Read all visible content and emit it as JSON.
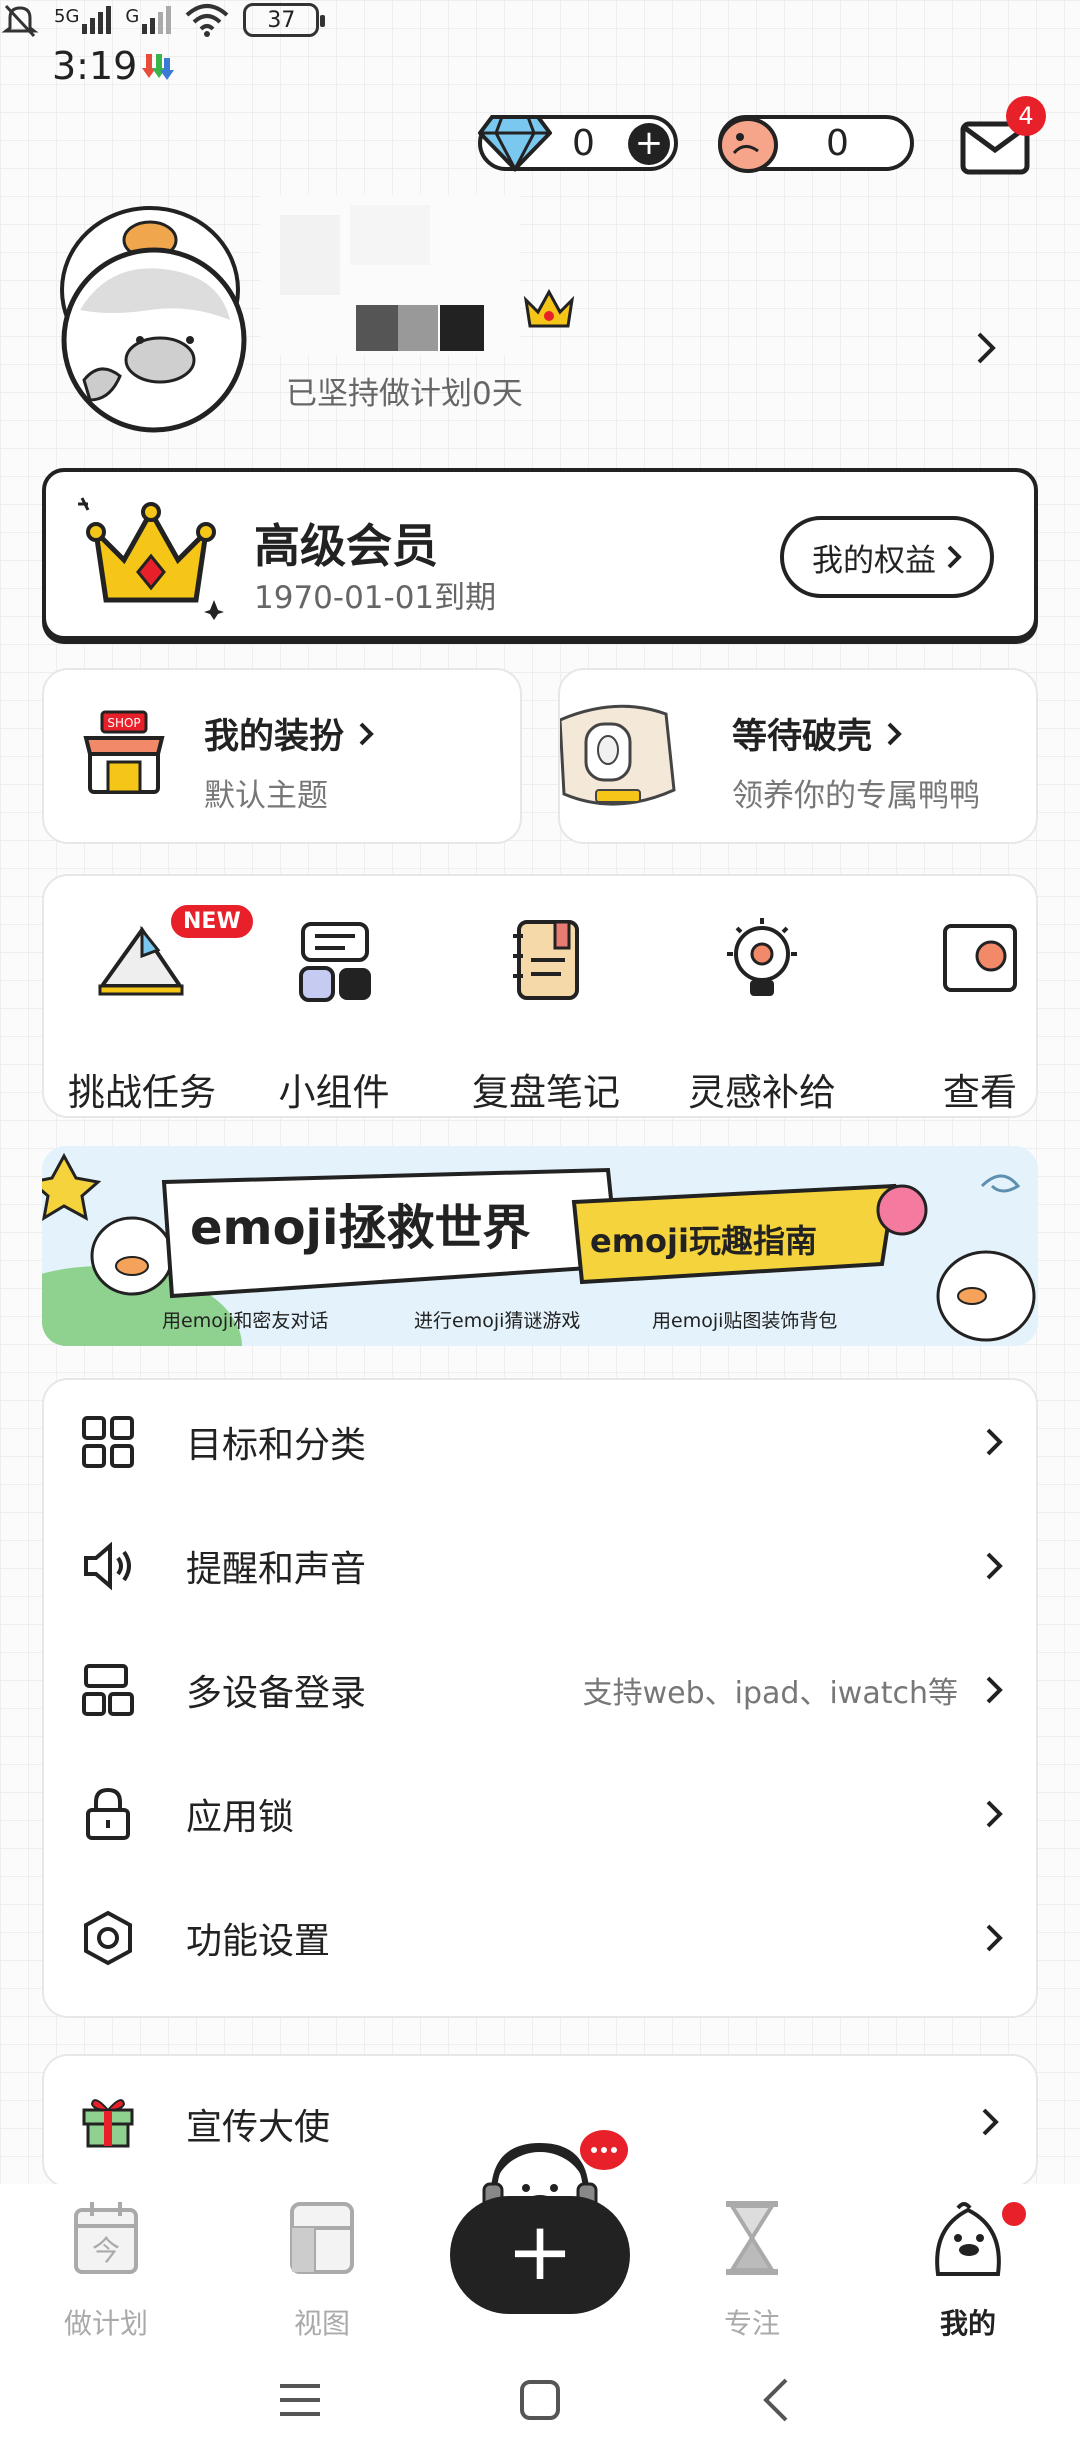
{
  "status_bar": {
    "time": "3:19",
    "network_label": "5G",
    "network_label_2": "G",
    "battery": "37"
  },
  "wallet": {
    "diamonds": "0",
    "eggs": "0",
    "mail_badge": "4"
  },
  "profile": {
    "persist_text": "已坚持做计划0天"
  },
  "member": {
    "title": "高级会员",
    "expiry": "1970-01-01到期",
    "rights_button": "我的权益"
  },
  "cards": {
    "dress_title": "我的装扮",
    "dress_sub": "默认主题",
    "hatch_title": "等待破壳",
    "hatch_sub": "领养你的专属鸭鸭",
    "shop_sign": "SHOP"
  },
  "quick": [
    {
      "label": "挑战任务",
      "icon": "challenge-icon",
      "badge": "NEW"
    },
    {
      "label": "小组件",
      "icon": "widget-icon"
    },
    {
      "label": "复盘笔记",
      "icon": "notebook-icon"
    },
    {
      "label": "灵感补给",
      "icon": "lightbulb-icon"
    },
    {
      "label": "查看",
      "icon": "view-icon"
    }
  ],
  "banner": {
    "title": "emoji拯救世界",
    "tag": "emoji玩趣指南",
    "items": [
      "用emoji和密友对话",
      "进行emoji猜谜游戏",
      "用emoji贴图装饰背包"
    ]
  },
  "settings": [
    {
      "label": "目标和分类",
      "icon": "grid-icon",
      "extra": ""
    },
    {
      "label": "提醒和声音",
      "icon": "speaker-icon",
      "extra": ""
    },
    {
      "label": "多设备登录",
      "icon": "devices-icon",
      "extra": "支持web、ipad、iwatch等"
    },
    {
      "label": "应用锁",
      "icon": "lock-icon",
      "extra": ""
    },
    {
      "label": "功能设置",
      "icon": "hexagon-settings-icon",
      "extra": ""
    }
  ],
  "promo": {
    "label": "宣传大使",
    "icon": "gift-icon"
  },
  "bottom_nav": {
    "items": [
      {
        "label": "做计划",
        "icon": "calendar-today-icon",
        "glyph": "今"
      },
      {
        "label": "视图",
        "icon": "layout-icon"
      },
      {
        "label": "",
        "icon": "plus-icon"
      },
      {
        "label": "专注",
        "icon": "hourglass-icon"
      },
      {
        "label": "我的",
        "icon": "duck-profile-icon"
      }
    ],
    "active": "我的",
    "fab_label": "+"
  },
  "colors": {
    "accent_dark": "#222222",
    "badge_red": "#e8202a",
    "crown_gold": "#f5c518",
    "banner_bg": "#e4f3fb"
  }
}
